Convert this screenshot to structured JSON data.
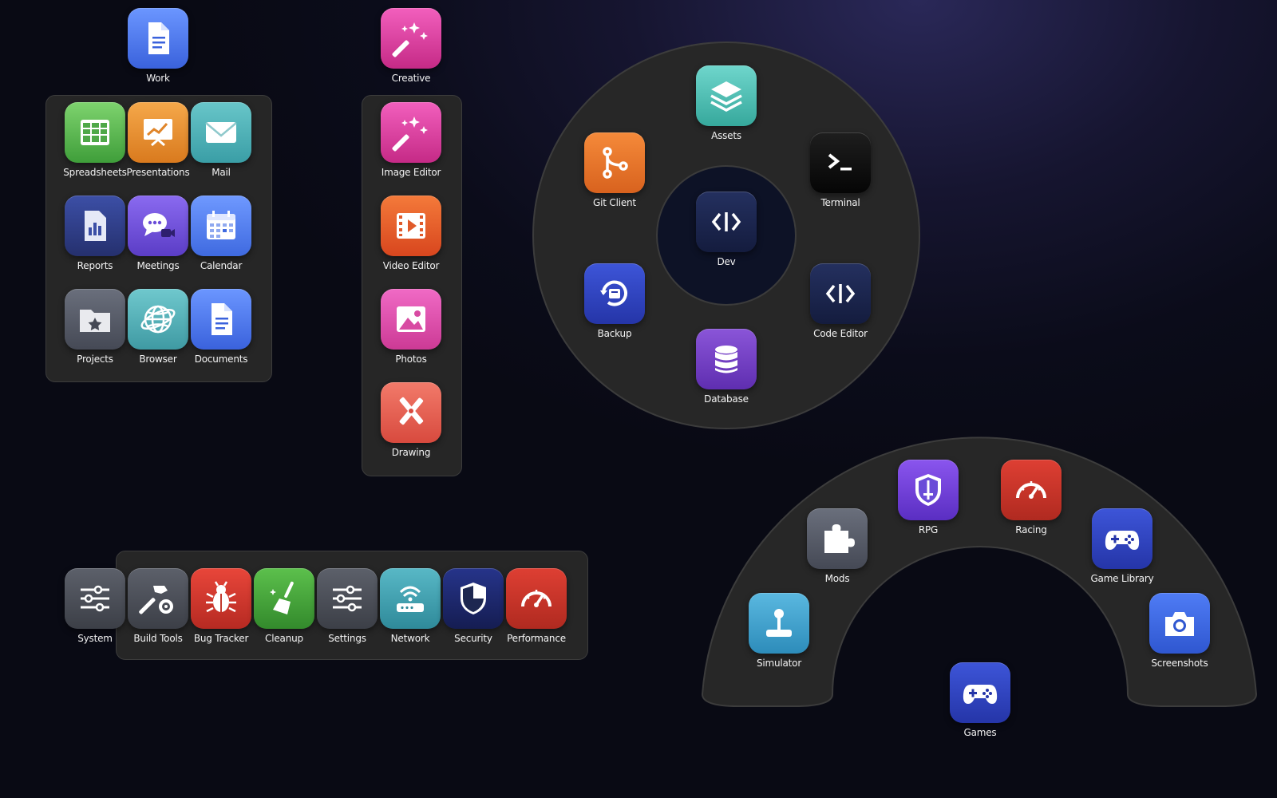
{
  "apps": {
    "work": "Work",
    "creative": "Creative",
    "spreadsheets": "Spreadsheets",
    "presentations": "Presentations",
    "mail": "Mail",
    "reports": "Reports",
    "meetings": "Meetings",
    "calendar": "Calendar",
    "projects": "Projects",
    "browser": "Browser",
    "documents": "Documents",
    "image_editor": "Image Editor",
    "video_editor": "Video Editor",
    "photos": "Photos",
    "drawing": "Drawing",
    "assets": "Assets",
    "git_client": "Git Client",
    "terminal": "Terminal",
    "dev": "Dev",
    "backup": "Backup",
    "code_editor": "Code Editor",
    "database": "Database",
    "system": "System",
    "build_tools": "Build Tools",
    "bug_tracker": "Bug Tracker",
    "cleanup": "Cleanup",
    "settings": "Settings",
    "network": "Network",
    "security": "Security",
    "performance": "Performance",
    "rpg": "RPG",
    "racing": "Racing",
    "mods": "Mods",
    "game_library": "Game Library",
    "simulator": "Simulator",
    "screenshots": "Screenshots",
    "games": "Games"
  },
  "colors": {
    "blue": "#4a7cf0",
    "pink": "#e0409e",
    "green": "#4fb648",
    "orange": "#ea8a2a",
    "teal": "#49aeb4",
    "navy": "#2b3a8c",
    "purple": "#6a4cd8",
    "gray": "#4c5059",
    "red": "#d83a2e",
    "dark_navy": "#1d2750"
  }
}
